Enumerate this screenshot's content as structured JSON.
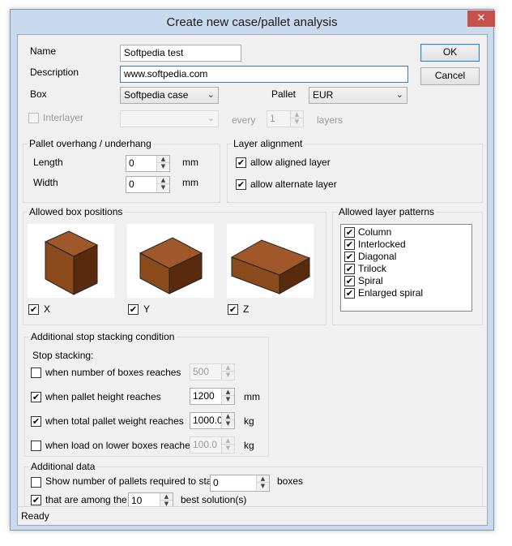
{
  "window": {
    "title": "Create new case/pallet analysis",
    "close_glyph": "✕"
  },
  "fields": {
    "name_label": "Name",
    "name_value": "Softpedia test",
    "description_label": "Description",
    "description_value": "www.softpedia.com",
    "box_label": "Box",
    "box_value": "Softpedia case",
    "pallet_label": "Pallet",
    "pallet_value": "EUR",
    "interlayer_label": "Interlayer",
    "interlayer_checked": false,
    "interlayer_combo_value": "",
    "every_label": "every",
    "every_value": "1",
    "layers_label": "layers"
  },
  "buttons": {
    "ok": "OK",
    "cancel": "Cancel"
  },
  "overhang": {
    "title": "Pallet overhang / underhang",
    "length_label": "Length",
    "length_value": "0",
    "width_label": "Width",
    "width_value": "0",
    "unit": "mm"
  },
  "layer_alignment": {
    "title": "Layer alignment",
    "aligned_label": "allow aligned layer",
    "aligned_checked": true,
    "alternate_label": "allow alternate layer",
    "alternate_checked": true
  },
  "box_positions": {
    "title": "Allowed box positions",
    "items": [
      {
        "label": "X",
        "checked": true
      },
      {
        "label": "Y",
        "checked": true
      },
      {
        "label": "Z",
        "checked": true
      }
    ],
    "box_color_front": "#8b4a1c",
    "box_color_side": "#5a2a0c",
    "box_color_top": "#a0582a"
  },
  "layer_patterns": {
    "title": "Allowed layer patterns",
    "items": [
      {
        "label": "Column",
        "checked": true
      },
      {
        "label": "Interlocked",
        "checked": true
      },
      {
        "label": "Diagonal",
        "checked": true
      },
      {
        "label": "Trilock",
        "checked": true
      },
      {
        "label": "Spiral",
        "checked": true
      },
      {
        "label": "Enlarged spiral",
        "checked": true
      }
    ]
  },
  "stop_stacking": {
    "title": "Additional stop stacking condition",
    "subtitle": "Stop stacking:",
    "rows": [
      {
        "label": "when number of boxes reaches",
        "checked": false,
        "value": "500",
        "unit": ""
      },
      {
        "label": "when pallet height reaches",
        "checked": true,
        "value": "1200",
        "unit": "mm"
      },
      {
        "label": "when total pallet weight reaches",
        "checked": true,
        "value": "1000.0",
        "unit": "kg"
      },
      {
        "label": "when load on lower boxes reaches",
        "checked": false,
        "value": "100.0",
        "unit": "kg"
      }
    ]
  },
  "additional_data": {
    "title": "Additional data",
    "show_pallets_label": "Show number of pallets required to stack",
    "show_pallets_checked": false,
    "show_pallets_value": "0",
    "show_pallets_unit": "boxes",
    "among_label": "that are among the",
    "among_checked": true,
    "among_value": "10",
    "among_unit": "best solution(s)"
  },
  "status": {
    "text": "Ready"
  },
  "colors": {
    "accent": "#3c7fb1",
    "frame": "#c9d9ee",
    "close": "#c7504b"
  },
  "icons": {
    "check": "✔",
    "up": "▲",
    "down": "▼",
    "dropdown": "⌄"
  }
}
